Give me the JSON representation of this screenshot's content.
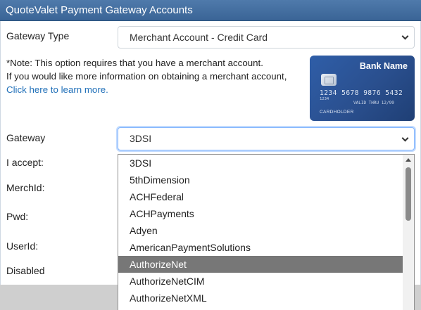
{
  "window": {
    "title": "QuoteValet Payment Gateway Accounts"
  },
  "gateway_type": {
    "label": "Gateway Type",
    "value": "Merchant Account - Credit Card"
  },
  "note": {
    "line1": "*Note: This option requires that you have a merchant account.",
    "line2": "If you would like more information on obtaining a merchant account,",
    "link": "Click here to learn more."
  },
  "card": {
    "bank_name": "Bank Name",
    "number": "1234 5678 9876 5432",
    "sub_number": "1234",
    "valid_label": "VALID THRU",
    "expiry": "12/99",
    "holder": "CARDHOLDER"
  },
  "gateway": {
    "label": "Gateway",
    "value": "3DSI"
  },
  "fields": {
    "i_accept": "I accept:",
    "merch_id": "MerchId:",
    "pwd": "Pwd:",
    "user_id": "UserId:",
    "disabled": "Disabled"
  },
  "dropdown": {
    "options": [
      "3DSI",
      "5thDimension",
      "ACHFederal",
      "ACHPayments",
      "Adyen",
      "AmericanPaymentSolutions",
      "AuthorizeNet",
      "AuthorizeNetCIM",
      "AuthorizeNetXML"
    ],
    "highlighted": "AuthorizeNet"
  }
}
